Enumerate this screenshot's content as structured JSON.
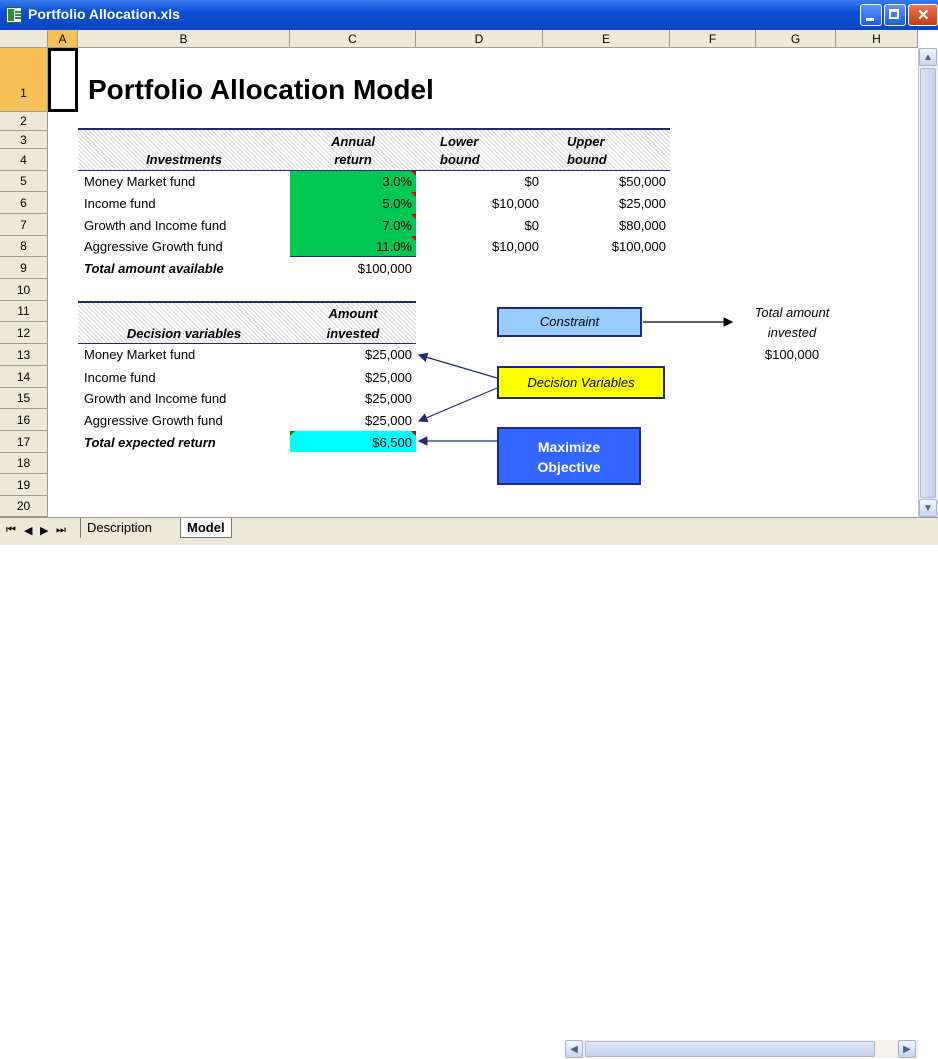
{
  "window": {
    "title": "Portfolio Allocation.xls"
  },
  "columns": [
    "A",
    "B",
    "C",
    "D",
    "E",
    "F",
    "G",
    "H"
  ],
  "rows": [
    "1",
    "2",
    "3",
    "4",
    "5",
    "6",
    "7",
    "8",
    "9",
    "10",
    "11",
    "12",
    "13",
    "14",
    "15",
    "16",
    "17",
    "18",
    "19",
    "20"
  ],
  "sheet": {
    "title": "Portfolio Allocation Model",
    "table1": {
      "h_investments": "Investments",
      "h_annual": "Annual",
      "h_return": "return",
      "h_lower": "Lower",
      "h_lower_bound": "bound",
      "h_upper": "Upper",
      "h_upper_bound": "bound",
      "rows": [
        {
          "name": "Money Market fund",
          "ret": "3.0%",
          "lower": "$0",
          "upper": "$50,000"
        },
        {
          "name": "Income fund",
          "ret": "5.0%",
          "lower": "$10,000",
          "upper": "$25,000"
        },
        {
          "name": "Growth and Income fund",
          "ret": "7.0%",
          "lower": "$0",
          "upper": "$80,000"
        },
        {
          "name": "Aggressive Growth fund",
          "ret": "11.0%",
          "lower": "$10,000",
          "upper": "$100,000"
        }
      ],
      "total_label": "Total amount available",
      "total_value": "$100,000"
    },
    "table2": {
      "h_decision": "Decision variables",
      "h_amount": "Amount",
      "h_invested": "invested",
      "rows": [
        {
          "name": "Money Market fund",
          "amount": "$25,000"
        },
        {
          "name": "Income fund",
          "amount": "$25,000"
        },
        {
          "name": "Growth and Income fund",
          "amount": "$25,000"
        },
        {
          "name": "Aggressive Growth fund",
          "amount": "$25,000"
        }
      ],
      "total_label": "Total expected return",
      "total_value": "$6,500"
    },
    "callouts": {
      "constraint": "Constraint",
      "decision": "Decision Variables",
      "objective_1": "Maximize",
      "objective_2": "Objective",
      "total_invested_1": "Total amount",
      "total_invested_2": "invested",
      "total_invested_value": "$100,000"
    }
  },
  "tabs": {
    "description": "Description",
    "model": "Model"
  },
  "colors": {
    "green": "#00c853",
    "cyan": "#00ffff",
    "constraint_box": "#99ccff",
    "decision_box": "#ffff00",
    "objective_box": "#3366ff",
    "navy": "#1f2a7a"
  }
}
